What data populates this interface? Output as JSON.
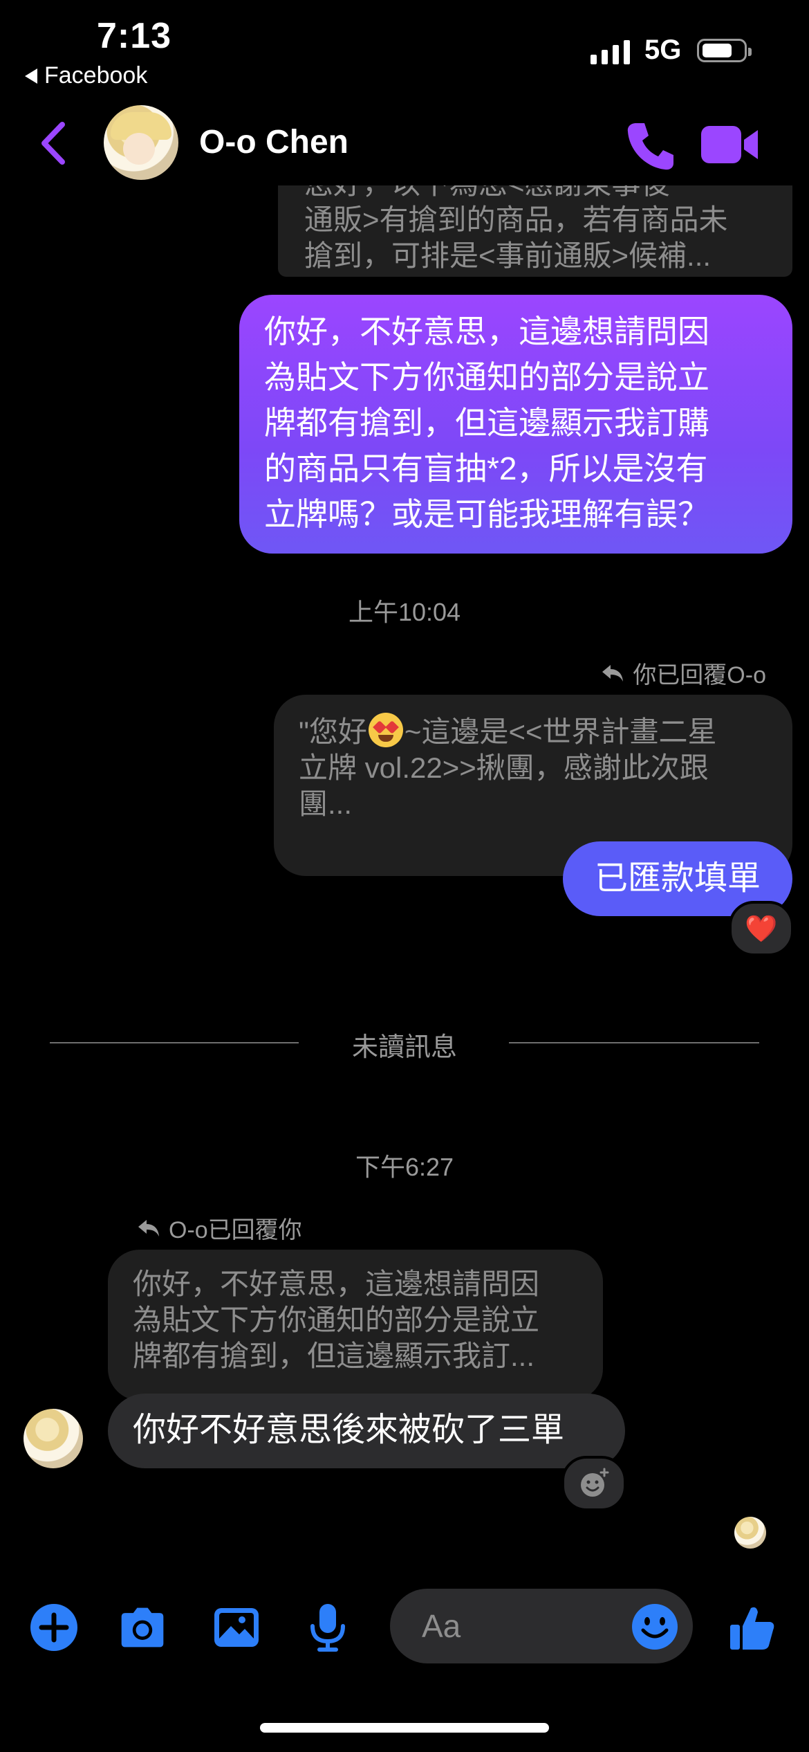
{
  "status_bar": {
    "time": "7:13",
    "back_app_label": "Facebook",
    "network": "5G"
  },
  "header": {
    "contact_name": "O-o Chen",
    "accent_color": "#9b46ff"
  },
  "messages": {
    "quoted_top": {
      "partial_line": "您好，以下為您<感謝東事後",
      "lines": [
        "通販>有搶到的商品，若有商品未",
        "搶到，可排是<事前通販>候補..."
      ]
    },
    "sent_question": {
      "lines": [
        "你好，不好意思，這邊想請問因",
        "為貼文下方你通知的部分是說立",
        "牌都有搶到，但這邊顯示我訂購",
        "的商品只有盲抽*2，所以是沒有",
        "立牌嗎？或是可能我理解有誤？"
      ]
    },
    "timestamp_1": "上午10:04",
    "replied_label_1": "你已回覆O-o",
    "quoted_mid": {
      "line1_prefix": "\"您好",
      "line1_suffix": "~這邊是<<世界計畫二星",
      "line2": "立牌 vol.22>>揪團，感謝此次跟",
      "line3": "團..."
    },
    "sent_paid": "已匯款填單",
    "reaction": "❤️",
    "unread_divider": "未讀訊息",
    "timestamp_2": "下午6:27",
    "replied_label_2": "O-o已回覆你",
    "quoted_bottom": {
      "lines": [
        "你好，不好意思，這邊想請問因",
        "為貼文下方你通知的部分是說立",
        "牌都有搶到，但這邊顯示我訂..."
      ]
    },
    "received_reply": "你好不好意思後來被砍了三單"
  },
  "composer": {
    "placeholder": "Aa",
    "icon_color": "#2d7ff9"
  }
}
